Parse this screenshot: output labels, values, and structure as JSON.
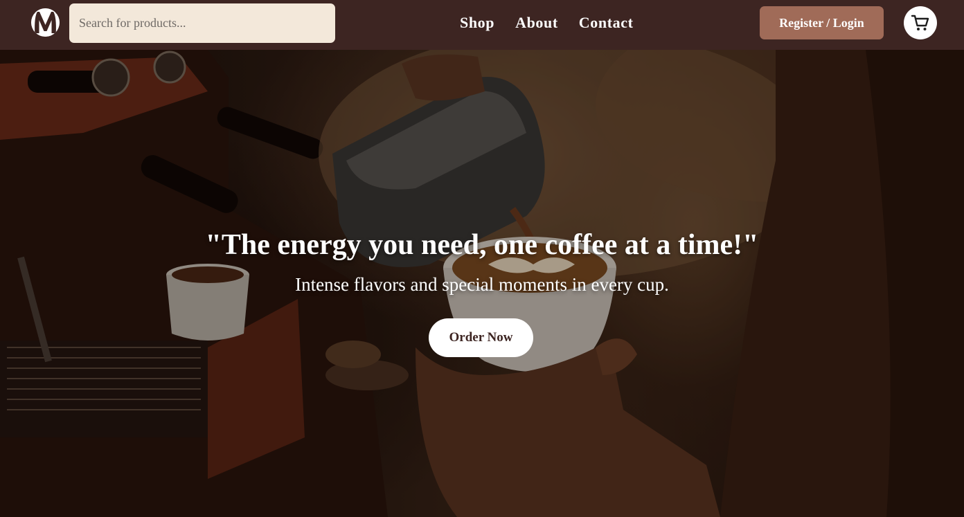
{
  "header": {
    "logo_icon": "coffee-brand-m-logo",
    "search": {
      "placeholder": "Search for products...",
      "value": ""
    },
    "nav": [
      {
        "label": "Shop"
      },
      {
        "label": "About"
      },
      {
        "label": "Contact"
      }
    ],
    "auth_label": "Register / Login",
    "cart_icon": "shopping-cart-icon"
  },
  "hero": {
    "background_image": "barista pouring latte art into a cup next to an espresso machine",
    "title": "\"The energy you need, one coffee at a time!\"",
    "subtitle": "Intense flavors and special moments in every cup.",
    "cta_label": "Order Now"
  },
  "colors": {
    "navbar": "#3d2522",
    "search_bg": "#f3e8da",
    "auth_button": "#a06b58",
    "cta_text": "#3d2522",
    "white": "#ffffff"
  }
}
